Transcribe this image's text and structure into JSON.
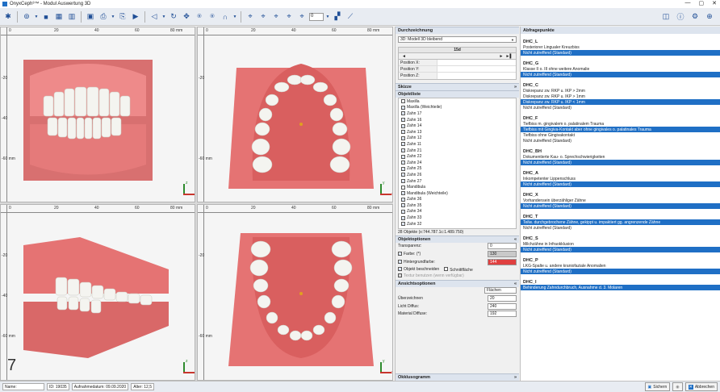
{
  "window": {
    "title": "OnyxCeph³™ - Modul Auswertung 3D",
    "controls": [
      "—",
      "▢",
      "✕"
    ]
  },
  "toolbar": {
    "zoom_value": "0"
  },
  "viewports": {
    "ticks": [
      "0",
      "20",
      "40",
      "60",
      "80 mm"
    ],
    "vticks": [
      "-20",
      "-40",
      "-60 mm"
    ],
    "axis_y": "y",
    "axis_z": "z",
    "axis_x": "x",
    "step_number": "7"
  },
  "mid": {
    "durchzeichnung": {
      "title": "Durchzeichnung",
      "selected": "3D: Modell 3D bleibend"
    },
    "nav": {
      "label": "15d",
      "prev": "◄",
      "next": "►",
      "last": "►▌"
    },
    "positions": [
      "Position X:",
      "Position Y:",
      "Position Z:"
    ],
    "skizze": {
      "title": "Skizze"
    },
    "objektliste": {
      "title": "Objektliste",
      "items": [
        {
          "label": "Maxilla",
          "checked": false
        },
        {
          "label": "Maxilla (Weichteile)",
          "checked": true
        },
        {
          "label": "Zahn 17",
          "checked": true
        },
        {
          "label": "Zahn 16",
          "checked": true
        },
        {
          "label": "Zahn 14",
          "checked": true
        },
        {
          "label": "Zahn 13",
          "checked": true
        },
        {
          "label": "Zahn 12",
          "checked": true
        },
        {
          "label": "Zahn 11",
          "checked": true
        },
        {
          "label": "Zahn 21",
          "checked": true
        },
        {
          "label": "Zahn 22",
          "checked": true
        },
        {
          "label": "Zahn 24",
          "checked": true
        },
        {
          "label": "Zahn 25",
          "checked": true
        },
        {
          "label": "Zahn 26",
          "checked": true
        },
        {
          "label": "Zahn 27",
          "checked": true
        },
        {
          "label": "Mandibula",
          "checked": false
        },
        {
          "label": "Mandibula (Weichteile)",
          "checked": true
        },
        {
          "label": "Zahn 36",
          "checked": true
        },
        {
          "label": "Zahn 35",
          "checked": true
        },
        {
          "label": "Zahn 34",
          "checked": true
        },
        {
          "label": "Zahn 33",
          "checked": true
        },
        {
          "label": "Zahn 32",
          "checked": true
        }
      ],
      "footer": "28 Objekte (x:744.787.1c:1.489.750)"
    },
    "objektoptionen": {
      "title": "Objektoptionen",
      "transparenz": "Transparenz:",
      "transparenz_val": "0",
      "farbe": "Farbe: (*)",
      "farbe_val": "130",
      "hintergrund": "Hintergrundfarbe:",
      "hintergrund_val": "144",
      "objekt_beschneiden": "Objekt beschneiden",
      "schnittflaeche": "Schnittfläche",
      "textur": "Textur benutzen (wenn verfügbar)"
    },
    "ansichtsoptionen": {
      "title": "Ansichtsoptionen",
      "mode": "Flächen",
      "ueberzeichnen": "Überzeichnen",
      "ueberzeichnen_val": "20",
      "licht": "Licht Diffus:",
      "licht_val": "240",
      "material": "Material Diffuse:",
      "material_val": "192"
    },
    "okklusogramm": {
      "title": "Okklusogramm"
    }
  },
  "right": {
    "title": "Abfragepunkte",
    "groups": [
      {
        "code": "DHC_L",
        "options": [
          {
            "t": "Posteriorer Lingualer Kreuzbiss",
            "sel": false
          },
          {
            "t": "Nicht zutreffend (Standard)",
            "sel": true
          }
        ]
      },
      {
        "code": "DHC_G",
        "options": [
          {
            "t": "Klasse II o. III ohne weitere Anomalie",
            "sel": false
          },
          {
            "t": "Nicht zutreffend (Standard)",
            "sel": true
          }
        ]
      },
      {
        "code": "DHC_C",
        "options": [
          {
            "t": "Diskrepanz zw. RKP u. IKP > 2mm",
            "sel": false
          },
          {
            "t": "Diskrepanz zw. RKP u. IKP > 1mm",
            "sel": false
          },
          {
            "t": "Diskrepanz zw. RKP u. IKP < 1mm",
            "sel": true
          },
          {
            "t": "Nicht zutreffend (Standard)",
            "sel": false
          }
        ]
      },
      {
        "code": "DHC_F",
        "options": [
          {
            "t": "Tiefbiss m. gingivalem o. palatinalem Trauma",
            "sel": false
          },
          {
            "t": "Tiefbiss mit Gingiva-Kontakt aber ohne gingivales o. palatinales Trauma",
            "sel": true
          },
          {
            "t": "Tiefbiss ohne Gingivakontakt",
            "sel": false
          },
          {
            "t": "Nicht zutreffend (Standard)",
            "sel": false
          }
        ]
      },
      {
        "code": "DHC_BH",
        "options": [
          {
            "t": "Dokumentierte Kau- o. Sprechschwierigkeiten",
            "sel": false
          },
          {
            "t": "Nicht zutreffend (Standard)",
            "sel": true
          }
        ]
      },
      {
        "code": "DHC_A",
        "options": [
          {
            "t": "Inkompetenter Lippenschluss",
            "sel": false
          },
          {
            "t": "Nicht zutreffend (Standard)",
            "sel": true
          }
        ]
      },
      {
        "code": "DHC_X",
        "options": [
          {
            "t": "Vorhandensein überzähliger Zähne",
            "sel": false
          },
          {
            "t": "Nicht zutreffend (Standard)",
            "sel": true
          }
        ]
      },
      {
        "code": "DHC_T",
        "options": [
          {
            "t": "Teilw. durchgebrochene Zähne, gekippt u. impaktiert gg. angrenzende Zähne",
            "sel": true
          },
          {
            "t": "Nicht zutreffend (Standard)",
            "sel": false
          }
        ]
      },
      {
        "code": "DHC_S",
        "options": [
          {
            "t": "Milchzähne in Infraokklusion",
            "sel": false
          },
          {
            "t": "Nicht zutreffend (Standard)",
            "sel": true
          }
        ]
      },
      {
        "code": "DHC_P",
        "options": [
          {
            "t": "LKG-Spalte u. andere kraniofaziale Anomalien",
            "sel": false
          },
          {
            "t": "Nicht zutreffend (Standard)",
            "sel": true
          }
        ]
      },
      {
        "code": "DHC_I",
        "options": [
          {
            "t": "Behinderung Zahndurchbruch, Ausnahme d. 3. Molaren",
            "sel": true
          }
        ]
      }
    ]
  },
  "status": {
    "name_label": "Name:",
    "id": "ID: 19035",
    "aufnahme": "Aufnahmedatum: 09.09.2020",
    "alter": "Alter: 12,5",
    "sichern": "Sichern",
    "abbrechen": "Abbrechen"
  },
  "colors": {
    "gum": "#e57373",
    "tooth": "#f4f4f0",
    "select": "#1f6fc5",
    "header": "#dde4ee"
  }
}
